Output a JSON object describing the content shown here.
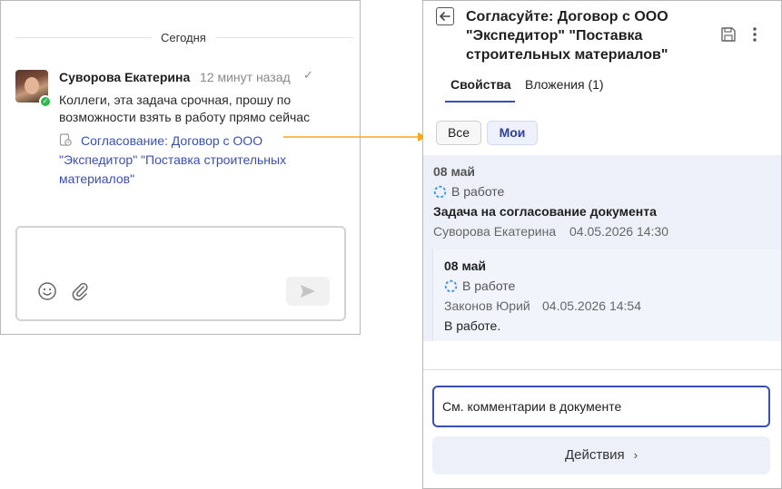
{
  "chat": {
    "date_separator": "Сегодня",
    "message": {
      "author": "Суворова Екатерина",
      "time": "12 минут назад",
      "text": "Коллеги, эта задача срочная, прошу по возможности взять в работу прямо сейчас",
      "task_link": "Согласование: Договор с ООО \"Экспедитор\" \"Поставка строительных материалов\""
    },
    "composer": {
      "value": "",
      "placeholder": ""
    }
  },
  "card": {
    "title": "Согласуйте: Договор с ООО \"Экспедитор\" \"Поставка строительных материалов\"",
    "tabs": [
      {
        "label": "Свойства",
        "active": true
      },
      {
        "label": "Вложения (1)",
        "active": false
      }
    ],
    "filters": [
      {
        "label": "Все",
        "active": false
      },
      {
        "label": "Мои",
        "active": true
      }
    ],
    "history": [
      {
        "date": "08 май",
        "status": "В работе",
        "task": "Задача на согласование документа",
        "author": "Суворова Екатерина",
        "timestamp": "04.05.2026 14:30"
      },
      {
        "date": "08 май",
        "status": "В работе",
        "author": "Законов Юрий",
        "timestamp": "04.05.2026 14:54",
        "comment": "В работе."
      }
    ],
    "comment_input": {
      "value": "См. комментарии в документе"
    },
    "actions_label": "Действия"
  },
  "colors": {
    "accent": "#3a4fb5",
    "arrow": "#f5a623",
    "online": "#2db94d",
    "panel_bg": "#eef0f9"
  }
}
